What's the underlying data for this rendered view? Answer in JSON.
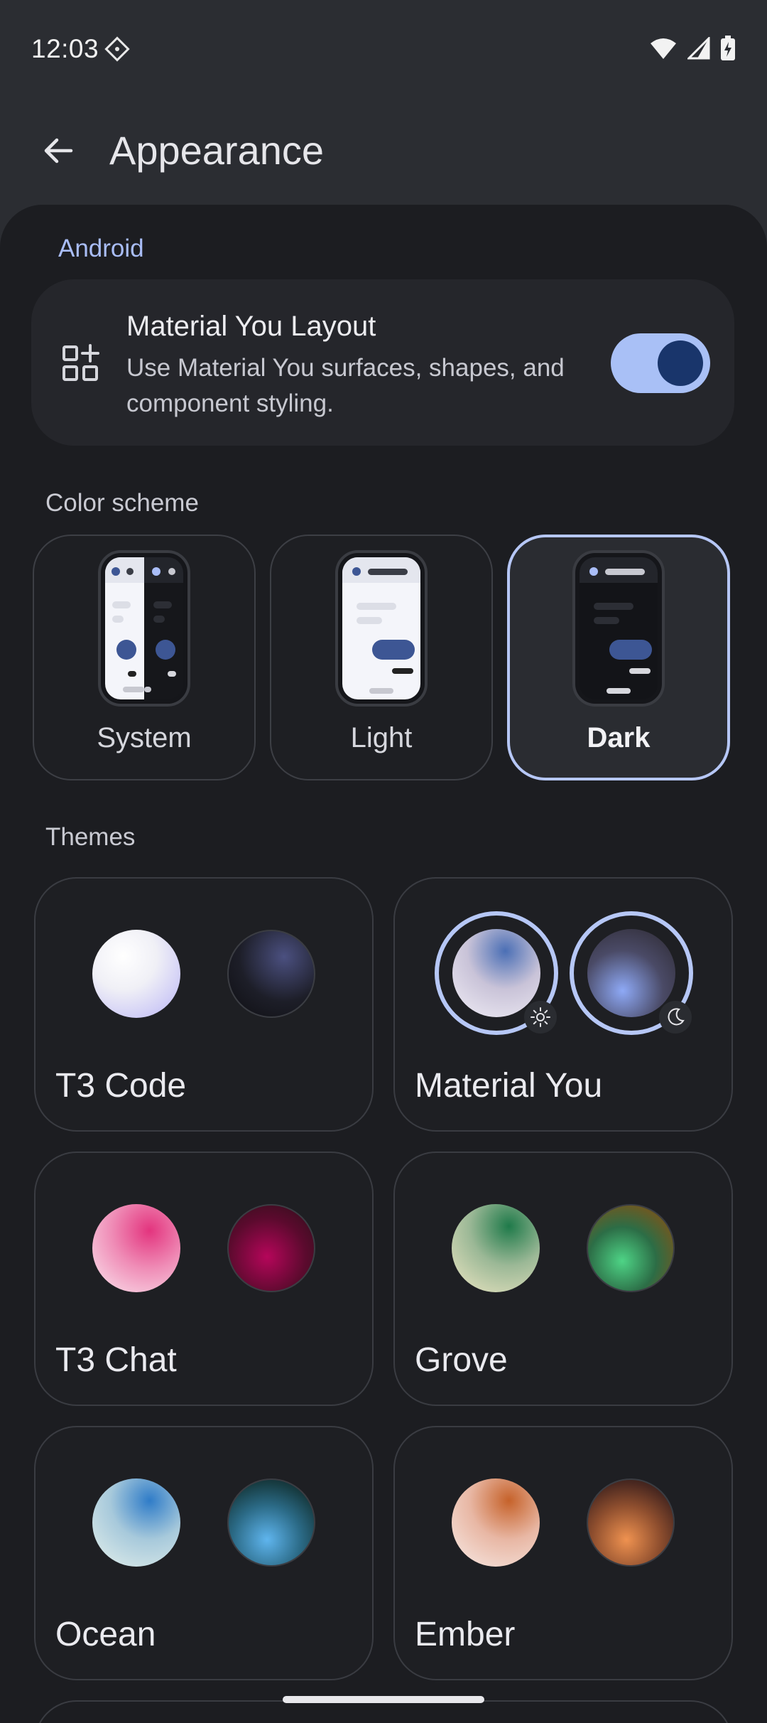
{
  "status": {
    "time": "12:03"
  },
  "header": {
    "title": "Appearance"
  },
  "android": {
    "section": "Android",
    "layout_title": "Material You Layout",
    "layout_subtitle": "Use Material You surfaces, shapes, and component styling.",
    "toggle_on": true
  },
  "color_scheme": {
    "section": "Color scheme",
    "options": [
      {
        "label": "System"
      },
      {
        "label": "Light"
      },
      {
        "label": "Dark",
        "selected": true
      }
    ]
  },
  "themes": {
    "section": "Themes",
    "items": [
      {
        "name": "T3 Code"
      },
      {
        "name": "Material You",
        "selected": true
      },
      {
        "name": "T3 Chat"
      },
      {
        "name": "Grove"
      },
      {
        "name": "Ocean"
      },
      {
        "name": "Ember"
      }
    ]
  },
  "colors": {
    "accent": "#b6c7f6",
    "toggle_track": "#a9c0f6",
    "toggle_thumb": "#19356b",
    "surface": "#1c1d21"
  }
}
